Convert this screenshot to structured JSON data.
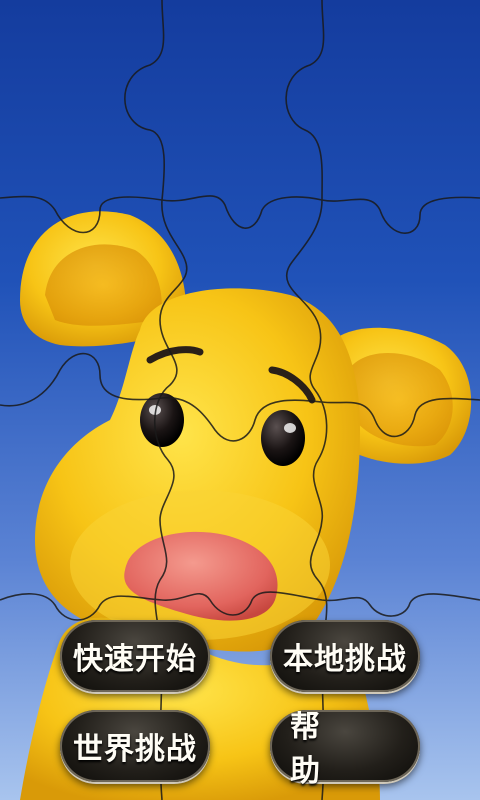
{
  "menu": {
    "quick_start": "快速开始",
    "local_challenge": "本地挑战",
    "world_challenge": "世界挑战",
    "help": "帮 助"
  },
  "colors": {
    "sky_top": "#143c9e",
    "sky_bottom": "#a8c4ee",
    "character_yellow": "#f6c21a",
    "nose_pink": "#e8706a",
    "button_dark": "#221f1a",
    "button_text": "#fffdf5"
  }
}
